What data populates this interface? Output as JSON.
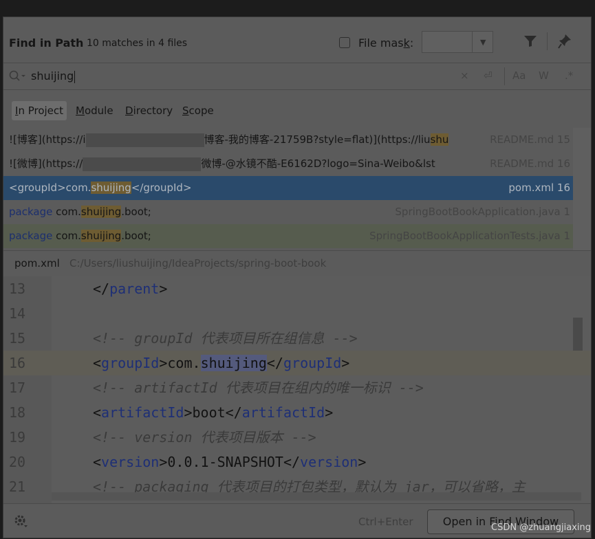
{
  "dialog": {
    "title": "Find in Path",
    "subtitle": "10 matches in 4 files",
    "file_mask_label_pre": "File mas",
    "file_mask_label_u": "k",
    "file_mask_label_post": ":",
    "file_mask_value": ""
  },
  "search": {
    "query": "shuijing",
    "clear_glyph": "×",
    "newline_glyph": "⏎",
    "match_case": "Aa",
    "whole_words": "W",
    "regex": ".*"
  },
  "scopes": [
    {
      "u": "I",
      "rest": "n Project",
      "active": true
    },
    {
      "u": "M",
      "rest": "odule"
    },
    {
      "u": "D",
      "rest": "irectory"
    },
    {
      "u": "S",
      "rest": "cope"
    }
  ],
  "results": [
    {
      "pre": "![博客](https://i",
      "post": "博客-我的博客-21759B?style=flat)](https://liu",
      "hl": "shu",
      "file": "README.md 15"
    },
    {
      "pre": "![微博](https://",
      "post": "微博-@水镜不酷-E6162D?logo=Sina-Weibo&lst",
      "file": "README.md 16"
    },
    {
      "pre": "<groupId>com.",
      "hl": "shuijing",
      "post": "</groupId>",
      "file": "pom.xml 16"
    },
    {
      "kw": "package",
      "pre": " com.",
      "hl": "shuijing",
      "post": ".boot;",
      "file": "SpringBootBookApplication.java 1"
    },
    {
      "kw": "package",
      "pre": " com.",
      "hl": "shuijing",
      "post": ".boot;",
      "file": "SpringBootBookApplicationTests.java 1"
    }
  ],
  "preview": {
    "file_name": "pom.xml",
    "file_path": "C:/Users/liushuijing/IdeaProjects/spring-boot-book",
    "lines": [
      {
        "n": "13",
        "a": "</",
        "t": "parent",
        "b": ">"
      },
      {
        "n": "14"
      },
      {
        "n": "15",
        "c": "<!-- groupId 代表项目所在组信息 -->"
      },
      {
        "n": "16",
        "a": "<",
        "t": "groupId",
        "b": ">com.",
        "m": "shuijing",
        "d": "</",
        "t2": "groupId",
        "e": ">"
      },
      {
        "n": "17",
        "c": "<!-- artifactId 代表项目在组内的唯一标识 -->"
      },
      {
        "n": "18",
        "a": "<",
        "t": "artifactId",
        "b": ">boot</",
        "t2": "artifactId",
        "e": ">"
      },
      {
        "n": "19",
        "c": "<!-- version 代表项目版本 -->"
      },
      {
        "n": "20",
        "a": "<",
        "t": "version",
        "b": ">0.0.1-SNAPSHOT</",
        "t2": "version",
        "e": ">"
      },
      {
        "n": "21",
        "c": "<!-- packaging 代表项目的打包类型，默认为 jar，可以省略，主"
      }
    ]
  },
  "footer": {
    "shortcut_hint": "Ctrl+Enter",
    "open_button": "Open in Find Window"
  },
  "watermark": "CSDN @zhuangjiaxing"
}
